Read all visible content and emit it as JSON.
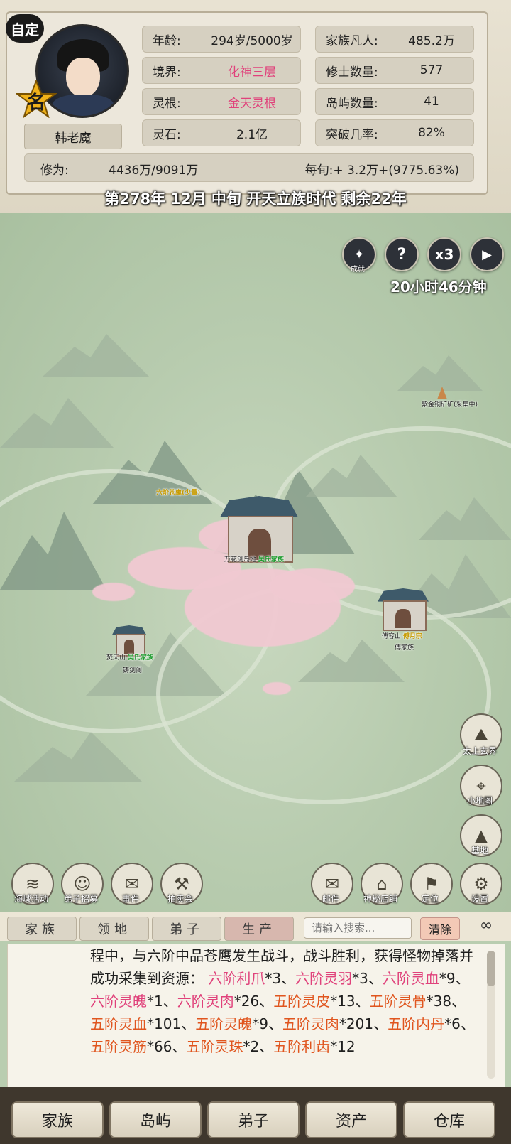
{
  "header": {
    "custom_badge": "自定",
    "name_badge_char": "名",
    "player_name": "韩老魔",
    "stats": [
      {
        "label": "年龄:",
        "value": "294岁/5000岁",
        "highlight": false
      },
      {
        "label": "家族凡人:",
        "value": "485.2万",
        "highlight": false
      },
      {
        "label": "境界:",
        "value": "化神三层",
        "highlight": true
      },
      {
        "label": "修士数量:",
        "value": "577",
        "highlight": false
      },
      {
        "label": "灵根:",
        "value": "金天灵根",
        "highlight": true
      },
      {
        "label": "岛屿数量:",
        "value": "41",
        "highlight": false
      },
      {
        "label": "灵石:",
        "value": "2.1亿",
        "highlight": false
      },
      {
        "label": "突破几率:",
        "value": "82%",
        "highlight": false
      }
    ],
    "cultivation_label": "修为:",
    "cultivation_value": "4436万/9091万",
    "per_turn": "每旬:+ 3.2万+(9775.63%)",
    "date_line": "第278年 12月 中旬  开天立族时代 剩余22年"
  },
  "controls": {
    "achievement_label": "成就",
    "help_icon": "?",
    "speed_label": "x3",
    "play_icon": "play-icon",
    "timer": "20小时46分钟"
  },
  "map": {
    "labels": {
      "mine": "紫金铜矿矿(采集中)",
      "eagle": "六阶苍鹰(少量)",
      "main_name": "万花剑岛地",
      "main_tag": "吴氏家族",
      "west_name": "焚天山",
      "west_tag": "吴氏家族",
      "west_sub": "铸剑阁",
      "east_name": "傅容山",
      "east_tag": "傅月宗",
      "east_sub": "傅家族"
    },
    "side_buttons": [
      "太上玄界",
      "小地图",
      "基地"
    ],
    "bottom_left_buttons": [
      "海域活动",
      "弟子招募",
      "事件",
      "拍卖会"
    ],
    "bottom_right_buttons": [
      "邮件",
      "神秘店铺",
      "定位",
      "设置"
    ]
  },
  "tabs": [
    {
      "label": "家族",
      "active": false
    },
    {
      "label": "领地",
      "active": false
    },
    {
      "label": "弟子",
      "active": false
    },
    {
      "label": "生产",
      "active": true
    }
  ],
  "search": {
    "placeholder": "请输入搜索..."
  },
  "clear_label": "清除",
  "log": {
    "plain_1": "程中，与六阶中品苍鹰发生战斗，战斗胜利，获得怪物掉落并成功采集到资源：",
    "items": [
      {
        "name": "六阶利爪",
        "qty": "*3",
        "color": "pink"
      },
      {
        "name": "六阶灵羽",
        "qty": "*3",
        "color": "pink"
      },
      {
        "name": "六阶灵血",
        "qty": "*9",
        "color": "pink"
      },
      {
        "name": "六阶灵魄",
        "qty": "*1",
        "color": "pink"
      },
      {
        "name": "六阶灵肉",
        "qty": "*26",
        "color": "pink"
      },
      {
        "name": "五阶灵皮",
        "qty": "*13",
        "color": "orange"
      },
      {
        "name": "五阶灵骨",
        "qty": "*38",
        "color": "orange"
      },
      {
        "name": "五阶灵血",
        "qty": "*101",
        "color": "orange"
      },
      {
        "name": "五阶灵魄",
        "qty": "*9",
        "color": "orange"
      },
      {
        "name": "五阶灵肉",
        "qty": "*201",
        "color": "orange"
      },
      {
        "name": "五阶内丹",
        "qty": "*6",
        "color": "orange"
      },
      {
        "name": "五阶灵筋",
        "qty": "*66",
        "color": "orange"
      },
      {
        "name": "五阶灵珠",
        "qty": "*2",
        "color": "orange"
      },
      {
        "name": "五阶利齿",
        "qty": "*12",
        "color": "orange"
      }
    ],
    "separator": "、"
  },
  "bottom_nav": [
    "家族",
    "岛屿",
    "弟子",
    "资产",
    "仓库"
  ],
  "colors": {
    "accent_pink": "#e0427b",
    "accent_orange": "#e0551e",
    "clan_green": "#1c9a2c"
  }
}
